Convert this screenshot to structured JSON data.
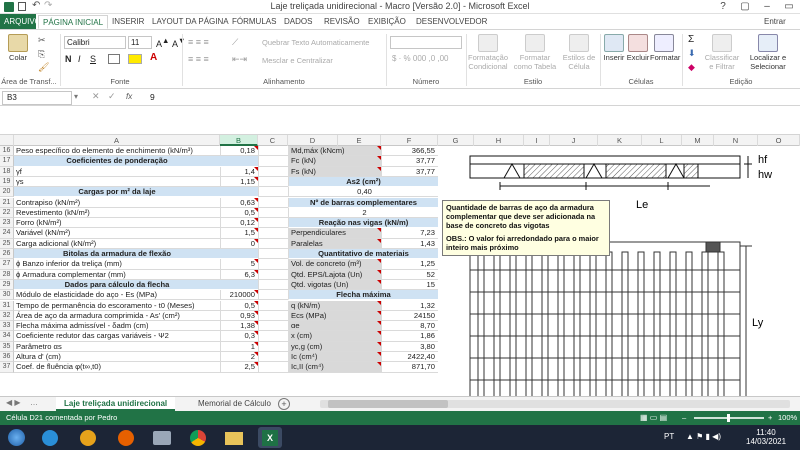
{
  "window": {
    "title": "Laje treliçada unidirecional - Macro [Versão 2.0] - Microsoft Excel",
    "signin": "Entrar"
  },
  "ribbon_tabs": [
    "ARQUIVO",
    "PÁGINA INICIAL",
    "INSERIR",
    "LAYOUT DA PÁGINA",
    "FÓRMULAS",
    "DADOS",
    "REVISÃO",
    "EXIBIÇÃO",
    "DESENVOLVEDOR"
  ],
  "ribbon": {
    "paste": "Colar",
    "font_name": "Calibri",
    "font_size": "11",
    "wrap_text": "Quebrar Texto Automaticamente",
    "merge_center": "Mesclar e Centralizar",
    "number_format": "",
    "cond_format": "Formatação Condicional",
    "format_table": "Formatar como Tabela",
    "cell_styles": "Estilos de Célula",
    "insert": "Inserir",
    "delete": "Excluir",
    "format": "Formatar",
    "sort_filter": "Classificar e Filtrar",
    "find_select": "Localizar e Selecionar",
    "groups": {
      "clipboard": "Área de Transf...",
      "font": "Fonte",
      "alignment": "Alinhamento",
      "number": "Número",
      "style": "Estilo",
      "cells": "Células",
      "editing": "Edição"
    }
  },
  "formula_bar": {
    "name_box": "B3",
    "fx": "fx",
    "value": "9"
  },
  "columns": [
    "A",
    "B",
    "C",
    "D",
    "E",
    "F",
    "G",
    "H",
    "I",
    "J",
    "K",
    "L",
    "M",
    "N",
    "O"
  ],
  "rows": [
    {
      "n": "16",
      "a": "Peso específico do elemento de enchimento (kN/m³)",
      "b": "0,18",
      "d": "Md,máx (kNcm)",
      "f": "366,55"
    },
    {
      "n": "17",
      "a": "Coeficientes de ponderação",
      "ahdr": true,
      "b": "",
      "d": "Fc (kN)",
      "f": "37,77"
    },
    {
      "n": "18",
      "a": "γf",
      "b": "1,4",
      "d": "Fs (kN)",
      "f": "37,77"
    },
    {
      "n": "19",
      "a": "γs",
      "b": "1,15",
      "d": "As2 (cm²)",
      "dhdr": true,
      "f": ""
    },
    {
      "n": "20",
      "a": "Cargas por m² da laje",
      "ahdr": true,
      "b": "",
      "d": "0,40",
      "dcenter": true,
      "f": ""
    },
    {
      "n": "21",
      "a": "Contrapiso (kN/m²)",
      "b": "0,63",
      "d": "Nº de barras complementares",
      "dhdr": true,
      "f": ""
    },
    {
      "n": "22",
      "a": "Revestimento (kN/m²)",
      "b": "0,5",
      "d": "2",
      "dcenter": true,
      "f": ""
    },
    {
      "n": "23",
      "a": "Forro (kN/m²)",
      "b": "0,12",
      "d": "Reação nas vigas (kN/m)",
      "dhdr": true,
      "f": ""
    },
    {
      "n": "24",
      "a": "Variável (kN/m²)",
      "b": "1,5",
      "d": "Perpendiculares",
      "f": "7,23"
    },
    {
      "n": "25",
      "a": "Carga adicional (kN/m²)",
      "b": "0",
      "d": "Paralelas",
      "f": "1,43"
    },
    {
      "n": "26",
      "a": "Bitolas da armadura de flexão",
      "ahdr": true,
      "b": "",
      "d": "Quantitativo de materiais",
      "dhdr": true,
      "f": ""
    },
    {
      "n": "27",
      "a": "ϕ Banzo inferior da treliça (mm)",
      "b": "5",
      "d": "Vol. de concreto (m³)",
      "f": "1,25"
    },
    {
      "n": "28",
      "a": "ϕ Armadura complementar (mm)",
      "b": "6,3",
      "d": "Qtd. EPS/Lajota (Un)",
      "f": "52"
    },
    {
      "n": "29",
      "a": "Dados para cálculo da flecha",
      "ahdr": true,
      "b": "",
      "d": "Qtd. vigotas (Un)",
      "f": "15"
    },
    {
      "n": "30",
      "a": "Módulo de elasticidade do aço - Es (MPa)",
      "b": "210000",
      "d": "Flecha máxima",
      "dhdr": true,
      "f": ""
    },
    {
      "n": "31",
      "a": "Tempo de permanência do escoramento - t0 (Meses)",
      "b": "0,5",
      "d": "q (kN/m)",
      "f": "1,32"
    },
    {
      "n": "32",
      "a": "Área de aço da armadura comprimida - As' (cm²)",
      "b": "0,93",
      "d": "Ecs (MPa)",
      "f": "24150"
    },
    {
      "n": "33",
      "a": "Flecha máxima admissível - δadm (cm)",
      "b": "1,38",
      "d": "αe",
      "f": "8,70"
    },
    {
      "n": "34",
      "a": "Coeficiente redutor das cargas variáveis - Ψ2",
      "b": "0,3",
      "d": "x (cm)",
      "f": "1,86"
    },
    {
      "n": "35",
      "a": "Parâmetro αs",
      "b": "1",
      "d": "yc,g (cm)",
      "f": "3,80"
    },
    {
      "n": "36",
      "a": "Altura d' (cm)",
      "b": "2",
      "d": "Ic (cm⁴)",
      "f": "2422,40"
    },
    {
      "n": "37",
      "a": "Coef. de fluência φ(t∞,t0)",
      "b": "2,5",
      "d": "Ic,II (cm⁴)",
      "f": "871,70"
    }
  ],
  "comment": {
    "line1": "Quantidade de barras de aço da armadura complementar que deve ser adicionada na base de concreto das vigotas",
    "line2": "OBS.: O valor foi arredondado para o maior inteiro mais próximo"
  },
  "drawing_labels": {
    "hf": "hf",
    "hw": "hw",
    "le": "Le",
    "ly": "Ly"
  },
  "sheet_tabs": [
    "Laje treliçada unidirecional",
    "Memorial de Cálculo"
  ],
  "status": {
    "left": "Célula D21 comentada por Pedro",
    "zoom": "100%"
  },
  "taskbar": {
    "lang": "PT",
    "time": "11:40",
    "date": "14/03/2021"
  },
  "colors": {
    "excel_green": "#217346",
    "header_blue": "#cfe2f3",
    "comment_yellow": "#ffffe1",
    "taskbar": "#1c2536"
  }
}
